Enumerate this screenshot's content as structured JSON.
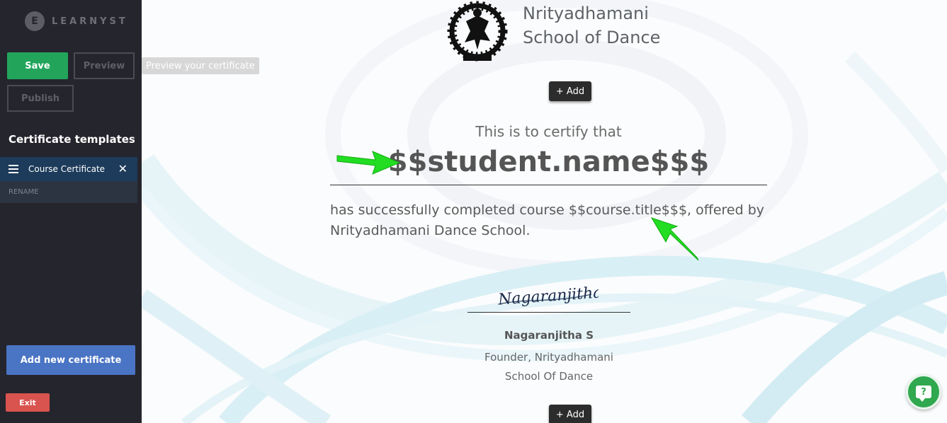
{
  "sidebar": {
    "brand": {
      "logo_letter": "E",
      "name": "LEARNYST"
    },
    "toolbar": {
      "save_label": "Save",
      "preview_label": "Preview",
      "publish_label": "Publish",
      "preview_tooltip": "Preview your certificate"
    },
    "templates_title": "Certificate templates",
    "templates": [
      {
        "label": "Course Certificate",
        "action_label": "RENAME"
      }
    ],
    "add_certificate_label": "Add new certificate",
    "exit_label": "Exit"
  },
  "certificate": {
    "school_name_line1": "Nrityadhamani",
    "school_name_line2": "School of Dance",
    "add_label": "+ Add",
    "certify_text": "This is to certify that",
    "student_placeholder": "$$student.name$$$",
    "body_text": "has successfully completed course $$course.title$$$, offered by Nrityadhamani Dance School.",
    "signature_text": "Nagaranjitha",
    "signer_name": "Nagaranjitha S",
    "signer_title_line1": "Founder, Nrityadhamani",
    "signer_title_line2": "School Of Dance"
  },
  "help_icon_label": "?",
  "colors": {
    "sidebar_bg": "#25252d",
    "save_green": "#22a55b",
    "add_cert_blue": "#4a74c4",
    "exit_red": "#d9534f",
    "selected_template_bg": "#1d3b5a",
    "arrow_green": "#22dd22",
    "help_green": "#2fa84f"
  }
}
